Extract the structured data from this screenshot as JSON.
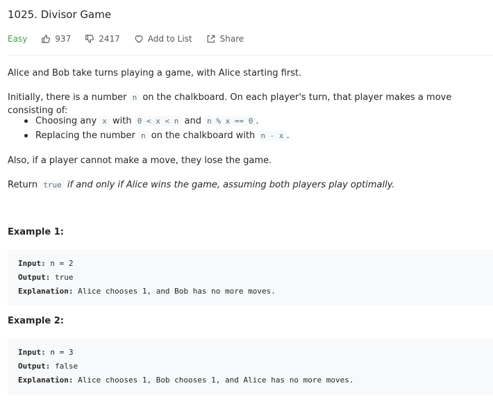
{
  "problem": {
    "title": "1025. Divisor Game",
    "difficulty": "Easy",
    "likes": "937",
    "dislikes": "2417",
    "add_to_list": "Add to List",
    "share": "Share"
  },
  "description": {
    "p1": "Alice and Bob take turns playing a game, with Alice starting first.",
    "p2_a": "Initially, there is a number ",
    "p2_code": "n",
    "p2_b": " on the chalkboard. On each player's turn, that player makes a move consisting of:",
    "bullet1_a": "Choosing any ",
    "bullet1_code1": "x",
    "bullet1_b": " with ",
    "bullet1_code2": "0 < x < n",
    "bullet1_c": " and ",
    "bullet1_code3": "n % x == 0",
    "bullet1_d": ".",
    "bullet2_a": "Replacing the number ",
    "bullet2_code1": "n",
    "bullet2_b": " on the chalkboard with ",
    "bullet2_code2": "n - x",
    "bullet2_c": ".",
    "p3": "Also, if a player cannot make a move, they lose the game.",
    "p4_a": "Return ",
    "p4_code": "true",
    "p4_b": " if and only if Alice wins the game, assuming both players play optimally."
  },
  "examples": [
    {
      "heading": "Example 1:",
      "input_label": "Input:",
      "input": " n = 2",
      "output_label": "Output:",
      "output": " true",
      "explanation_label": "Explanation:",
      "explanation": " Alice chooses 1, and Bob has no more moves."
    },
    {
      "heading": "Example 2:",
      "input_label": "Input:",
      "input": " n = 3",
      "output_label": "Output:",
      "output": " false",
      "explanation_label": "Explanation:",
      "explanation": " Alice chooses 1, Bob chooses 1, and Alice has no more moves."
    }
  ],
  "colors": {
    "easy": "#43a047",
    "code_bg": "#f7f9fa"
  }
}
